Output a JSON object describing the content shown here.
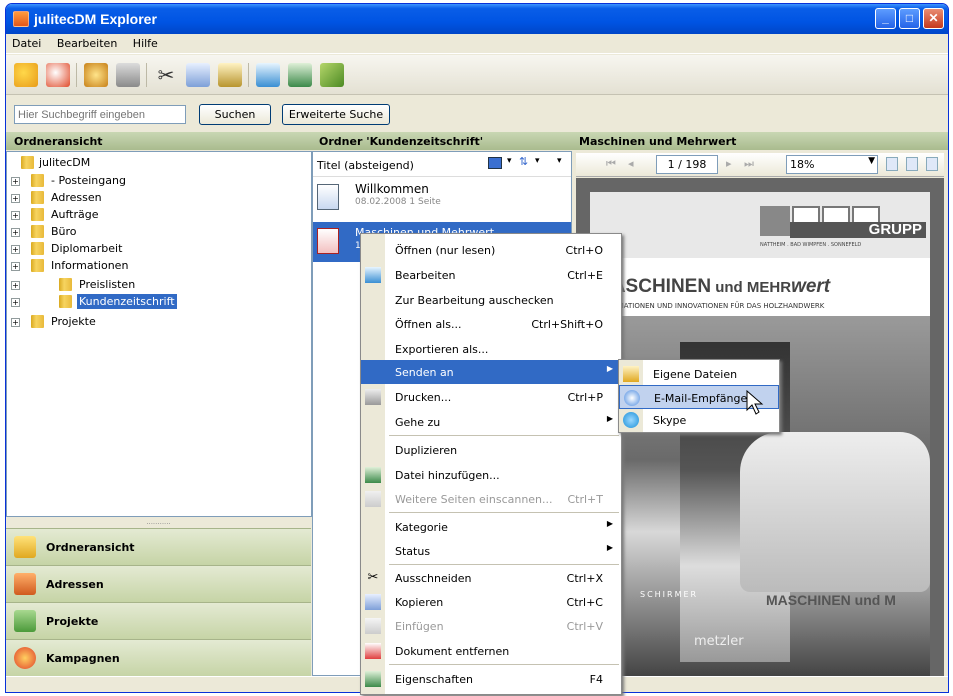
{
  "window": {
    "title": "julitecDM Explorer",
    "minimize": "_",
    "maximize": "□",
    "close": "✕"
  },
  "menu": {
    "items": [
      "Datei",
      "Bearbeiten",
      "Hilfe"
    ]
  },
  "search": {
    "placeholder": "Hier Suchbegriff eingeben",
    "search_button": "Suchen",
    "advanced_button": "Erweiterte Suche"
  },
  "headers": {
    "left": "Ordneransicht",
    "middle": "Ordner 'Kundenzeitschrift'",
    "right": "Maschinen und Mehrwert"
  },
  "tree": {
    "root": "julitecDM",
    "items": [
      "- Posteingang",
      "Adressen",
      "Aufträge",
      "Büro",
      "Diplomarbeit",
      "Informationen",
      "Preislisten",
      "Kundenzeitschrift",
      "Projekte"
    ]
  },
  "nav": {
    "grip": "...........",
    "items": [
      "Ordneransicht",
      "Adressen",
      "Projekte",
      "Kampagnen"
    ]
  },
  "list": {
    "sort_label": "Titel (absteigend)",
    "docs": [
      {
        "title": "Willkommen",
        "meta": "08.02.2008 1 Seite"
      },
      {
        "title": "Maschinen und Mehrwert",
        "meta": "12"
      }
    ]
  },
  "preview": {
    "page": "1 / 198",
    "zoom": "18%"
  },
  "page_content": {
    "logo": "GRUPP",
    "logo_sub": "NATTHEIM . BAD WIMPFEN . SONNEFELD",
    "headline_a": "MASCHINEN",
    "headline_b": " und MEHR",
    "headline_c": "wert",
    "subline": "INFORMATIONEN UND INNOVATIONEN FÜR DAS HOLZHANDWERK",
    "car_text": "MASCHINEN und M",
    "brand1": "SCHIRMER",
    "brand2": "metzler"
  },
  "context_menu": {
    "items": [
      {
        "label": "Öffnen (nur lesen)",
        "shortcut": "Ctrl+O"
      },
      {
        "label": "Bearbeiten",
        "shortcut": "Ctrl+E"
      },
      {
        "label": "Zur Bearbeitung auschecken",
        "shortcut": ""
      },
      {
        "label": "Öffnen als...",
        "shortcut": "Ctrl+Shift+O"
      },
      {
        "label": "Exportieren als...",
        "shortcut": ""
      },
      {
        "label": "Senden an",
        "shortcut": ""
      },
      {
        "label": "Drucken...",
        "shortcut": "Ctrl+P"
      },
      {
        "label": "Gehe zu",
        "shortcut": ""
      },
      {
        "label": "Duplizieren",
        "shortcut": ""
      },
      {
        "label": "Datei hinzufügen...",
        "shortcut": ""
      },
      {
        "label": "Weitere Seiten einscannen...",
        "shortcut": "Ctrl+T"
      },
      {
        "label": "Kategorie",
        "shortcut": ""
      },
      {
        "label": "Status",
        "shortcut": ""
      },
      {
        "label": "Ausschneiden",
        "shortcut": "Ctrl+X"
      },
      {
        "label": "Kopieren",
        "shortcut": "Ctrl+C"
      },
      {
        "label": "Einfügen",
        "shortcut": "Ctrl+V"
      },
      {
        "label": "Dokument entfernen",
        "shortcut": ""
      },
      {
        "label": "Eigenschaften",
        "shortcut": "F4"
      }
    ]
  },
  "submenu": {
    "items": [
      "Eigene Dateien",
      "E-Mail-Empfänger",
      "Skype"
    ]
  }
}
